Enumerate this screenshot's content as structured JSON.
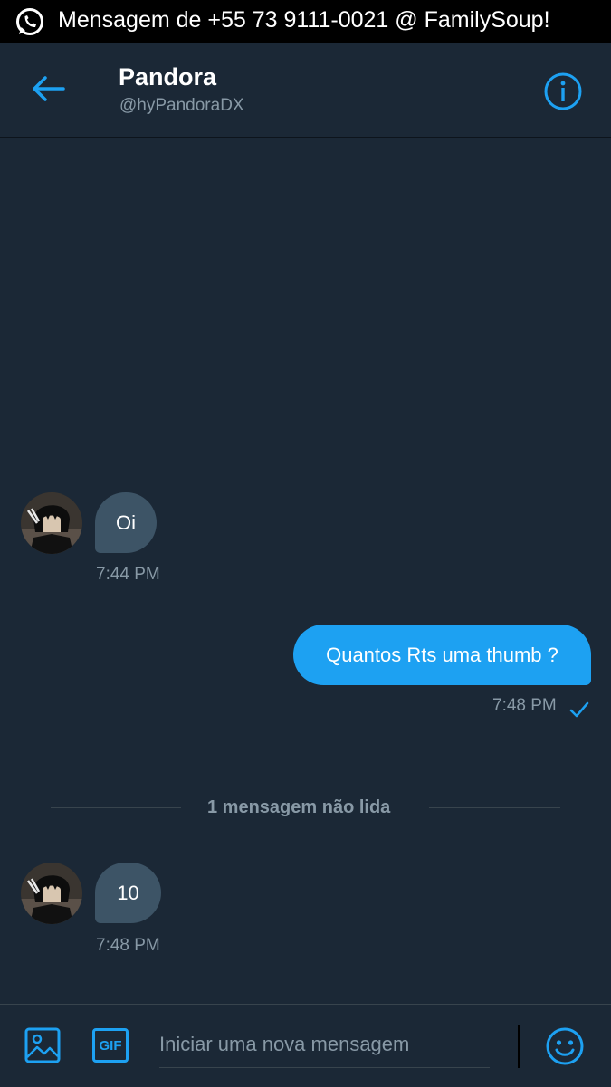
{
  "notification": {
    "app_icon": "whatsapp-icon",
    "text": "Mensagem de +55 73 9111-0021 @ FamilySoup!"
  },
  "header": {
    "back_icon": "arrow-left-icon",
    "name": "Pandora",
    "handle": "@hyPandoraDX",
    "info_icon": "info-icon"
  },
  "messages": [
    {
      "direction": "incoming",
      "text": "Oi",
      "time": "7:44 PM"
    },
    {
      "direction": "outgoing",
      "text": "Quantos Rts uma thumb ?",
      "time": "7:48 PM",
      "status_icon": "check-icon"
    },
    {
      "direction": "incoming",
      "text": "10",
      "time": "7:48 PM"
    }
  ],
  "unread_divider": "1 mensagem não lida",
  "composer": {
    "image_icon": "image-icon",
    "gif_label": "GIF",
    "placeholder": "Iniciar uma nova mensagem",
    "emoji_icon": "emoji-icon"
  },
  "colors": {
    "background": "#1b2836",
    "accent": "#1da1f2",
    "incoming_bubble": "#3d5466",
    "secondary_text": "#8899a6"
  }
}
